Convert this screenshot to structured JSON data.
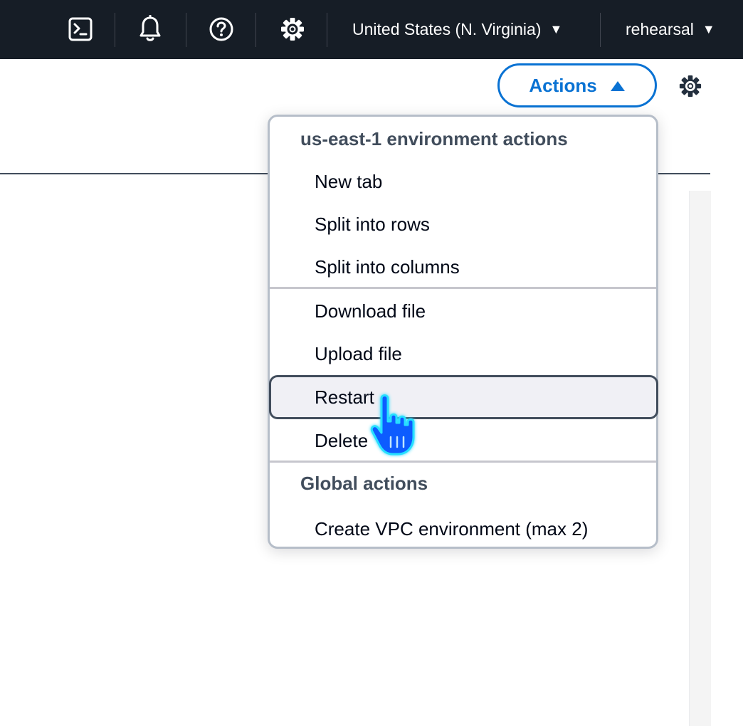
{
  "topnav": {
    "region": "United States (N. Virginia)",
    "user": "rehearsal",
    "caret": "▼",
    "icons": [
      "cloudshell-icon",
      "bell-icon",
      "help-icon",
      "gear-icon"
    ]
  },
  "toolbar": {
    "actions_label": "Actions",
    "actions_caret": "▲"
  },
  "menu": {
    "group1": {
      "header": "us-east-1 environment actions",
      "items": [
        "New tab",
        "Split into rows",
        "Split into columns",
        "Download file",
        "Upload file",
        "Restart",
        "Delete"
      ]
    },
    "group2": {
      "header": "Global actions",
      "items": [
        "Create VPC environment (max 2)"
      ]
    },
    "highlighted_item": "Restart"
  },
  "colors": {
    "nav_bg": "#161d26",
    "accent": "#0972d3",
    "hover_bg": "#f0f0f5",
    "cursor": "#0a5bff"
  }
}
